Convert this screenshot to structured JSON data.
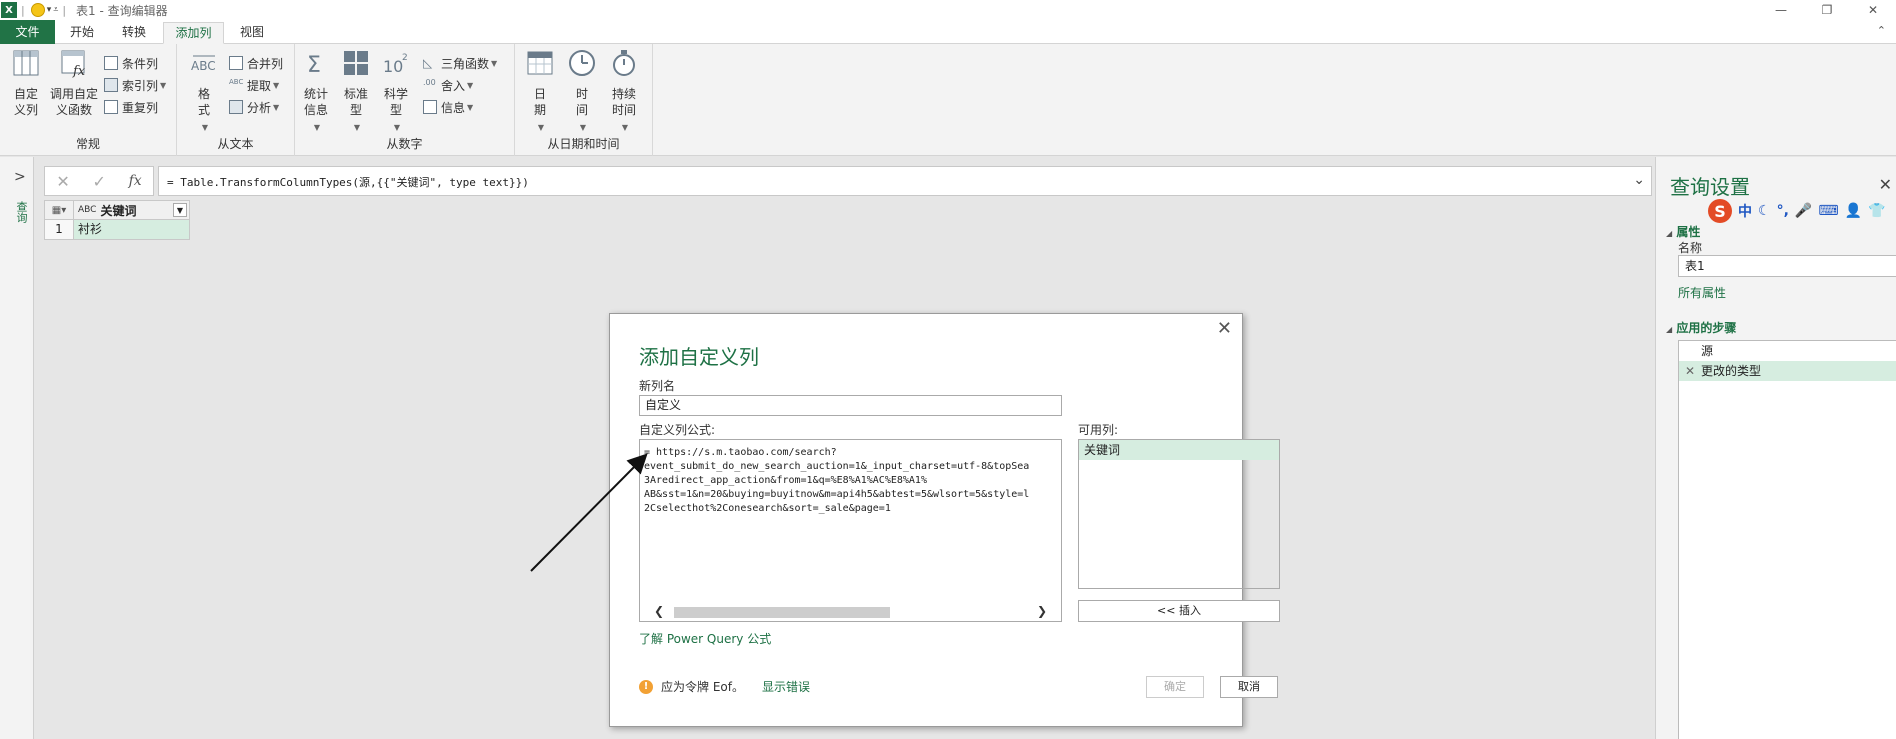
{
  "titlebar": {
    "app_icon": "X",
    "title": "表1 - 查询编辑器",
    "controls": [
      "—",
      "❐",
      "✕"
    ]
  },
  "tabs": {
    "file": "文件",
    "home": "开始",
    "transform": "转换",
    "add_column": "添加列",
    "view": "视图"
  },
  "ribbon": {
    "general": {
      "label": "常规",
      "custom_column": "自定\n义列",
      "invoke_custom_function": "调用自定\n义函数",
      "conditional_column": "条件列",
      "index_column": "索引列",
      "duplicate_column": "重复列"
    },
    "from_text": {
      "label": "从文本",
      "format": "格\n式",
      "merge_columns": "合并列",
      "extract": "提取",
      "parse": "分析"
    },
    "from_number": {
      "label": "从数字",
      "statistics": "统计\n信息",
      "standard": "标准\n型",
      "scientific": "科学\n型",
      "trigonometry": "三角函数",
      "rounding": "舍入",
      "information": "信息"
    },
    "from_datetime": {
      "label": "从日期和时间",
      "date": "日\n期",
      "time": "时\n间",
      "duration": "持续\n时间"
    }
  },
  "leftnav": {
    "vertical_label": "查询"
  },
  "formula_bar": {
    "text": "= Table.TransformColumnTypes(源,{{\"关键词\", type text}})"
  },
  "grid": {
    "column": "关键词",
    "type_badge": "ABC",
    "rows": [
      {
        "num": "1",
        "value": "衬衫"
      }
    ]
  },
  "query_settings": {
    "title": "查询设置",
    "properties_label": "属性",
    "name_label": "名称",
    "name_value": "表1",
    "all_properties": "所有属性",
    "applied_steps_label": "应用的步骤",
    "steps": [
      "源",
      "更改的类型"
    ]
  },
  "dialog": {
    "title": "添加自定义列",
    "new_column_name_label": "新列名",
    "new_column_name_value": "自定义",
    "formula_label": "自定义列公式:",
    "formula_text": "= https://s.m.taobao.com/search?\nevent_submit_do_new_search_auction=1&_input_charset=utf-8&topSea\n3Aredirect_app_action&from=1&q=%E8%A1%AC%E8%A1%\nAB&sst=1&n=20&buying=buyitnow&m=api4h5&abtest=5&wlsort=5&style=l\n2Cselecthot%2Conesearch&sort=_sale&page=1",
    "available_columns_label": "可用列:",
    "available_columns": [
      "关键词"
    ],
    "insert_button": "<< 插入",
    "learn_link": "了解 Power Query 公式",
    "warning_text": "应为令牌 Eof。",
    "show_error_link": "显示错误",
    "ok_button": "确定",
    "cancel_button": "取消"
  }
}
